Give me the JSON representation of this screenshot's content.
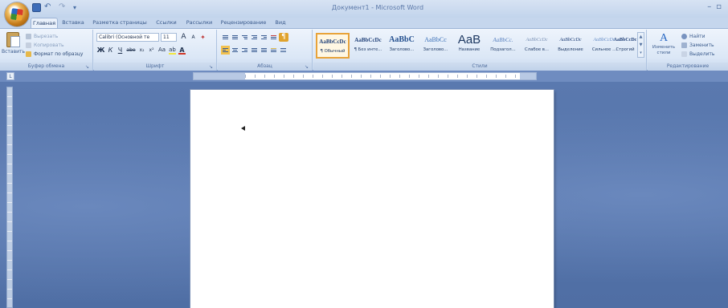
{
  "app": {
    "window_title": "Документ1 - Microsoft Word",
    "quick_access": {
      "undo_icon": "undo-icon",
      "redo_icon": "redo-icon"
    }
  },
  "tabs": [
    {
      "label": "Главная",
      "active": true
    },
    {
      "label": "Вставка"
    },
    {
      "label": "Разметка страницы"
    },
    {
      "label": "Ссылки"
    },
    {
      "label": "Рассылки"
    },
    {
      "label": "Рецензирование"
    },
    {
      "label": "Вид"
    }
  ],
  "ribbon": {
    "clipboard": {
      "paste_label": "Вставить",
      "cut_label": "Вырезать",
      "copy_label": "Копировать",
      "format_painter_label": "Формат по образцу",
      "group_label": "Буфер обмена"
    },
    "font": {
      "font_name": "Calibri (Основной те",
      "font_size": "11",
      "grow_label": "A",
      "shrink_label": "A",
      "bold": "Ж",
      "italic": "К",
      "underline": "Ч",
      "strike": "abe",
      "subscript": "x₂",
      "superscript": "x²",
      "case": "Aa",
      "highlight": "ab",
      "color": "A",
      "group_label": "Шрифт"
    },
    "paragraph": {
      "group_label": "Абзац",
      "pilcrow": "¶"
    },
    "styles": {
      "group_label": "Стили",
      "items": [
        {
          "sample": "AaBbCcDc",
          "name": "¶ Обычный",
          "selected": true
        },
        {
          "sample": "AaBbCcDc",
          "name": "¶ Без инте..."
        },
        {
          "sample": "AaBbC",
          "name": "Заголово..."
        },
        {
          "sample": "AaBbCc",
          "name": "Заголово..."
        },
        {
          "sample": "AaB",
          "name": "Название"
        },
        {
          "sample": "AaBbCc.",
          "name": "Подзагол..."
        },
        {
          "sample": "AaBbCcDc",
          "name": "Слабое в..."
        },
        {
          "sample": "AaBbCcDc",
          "name": "Выделение"
        },
        {
          "sample": "AaBbCcDc",
          "name": "Сильное ..."
        },
        {
          "sample": "AaBbCcDc",
          "name": "Строгий"
        }
      ]
    },
    "change_styles": {
      "label_line1": "Изменить",
      "label_line2": "стили"
    },
    "editing": {
      "find_label": "Найти",
      "replace_label": "Заменить",
      "select_label": "Выделить",
      "group_label": "Редактирование"
    }
  },
  "colors": {
    "accent_blue": "#2a69c4",
    "selected_style_border": "#e8a33a",
    "workspace": "#5876ab",
    "highlight_yellow": "#f2e640",
    "font_red": "#d23a2a"
  }
}
